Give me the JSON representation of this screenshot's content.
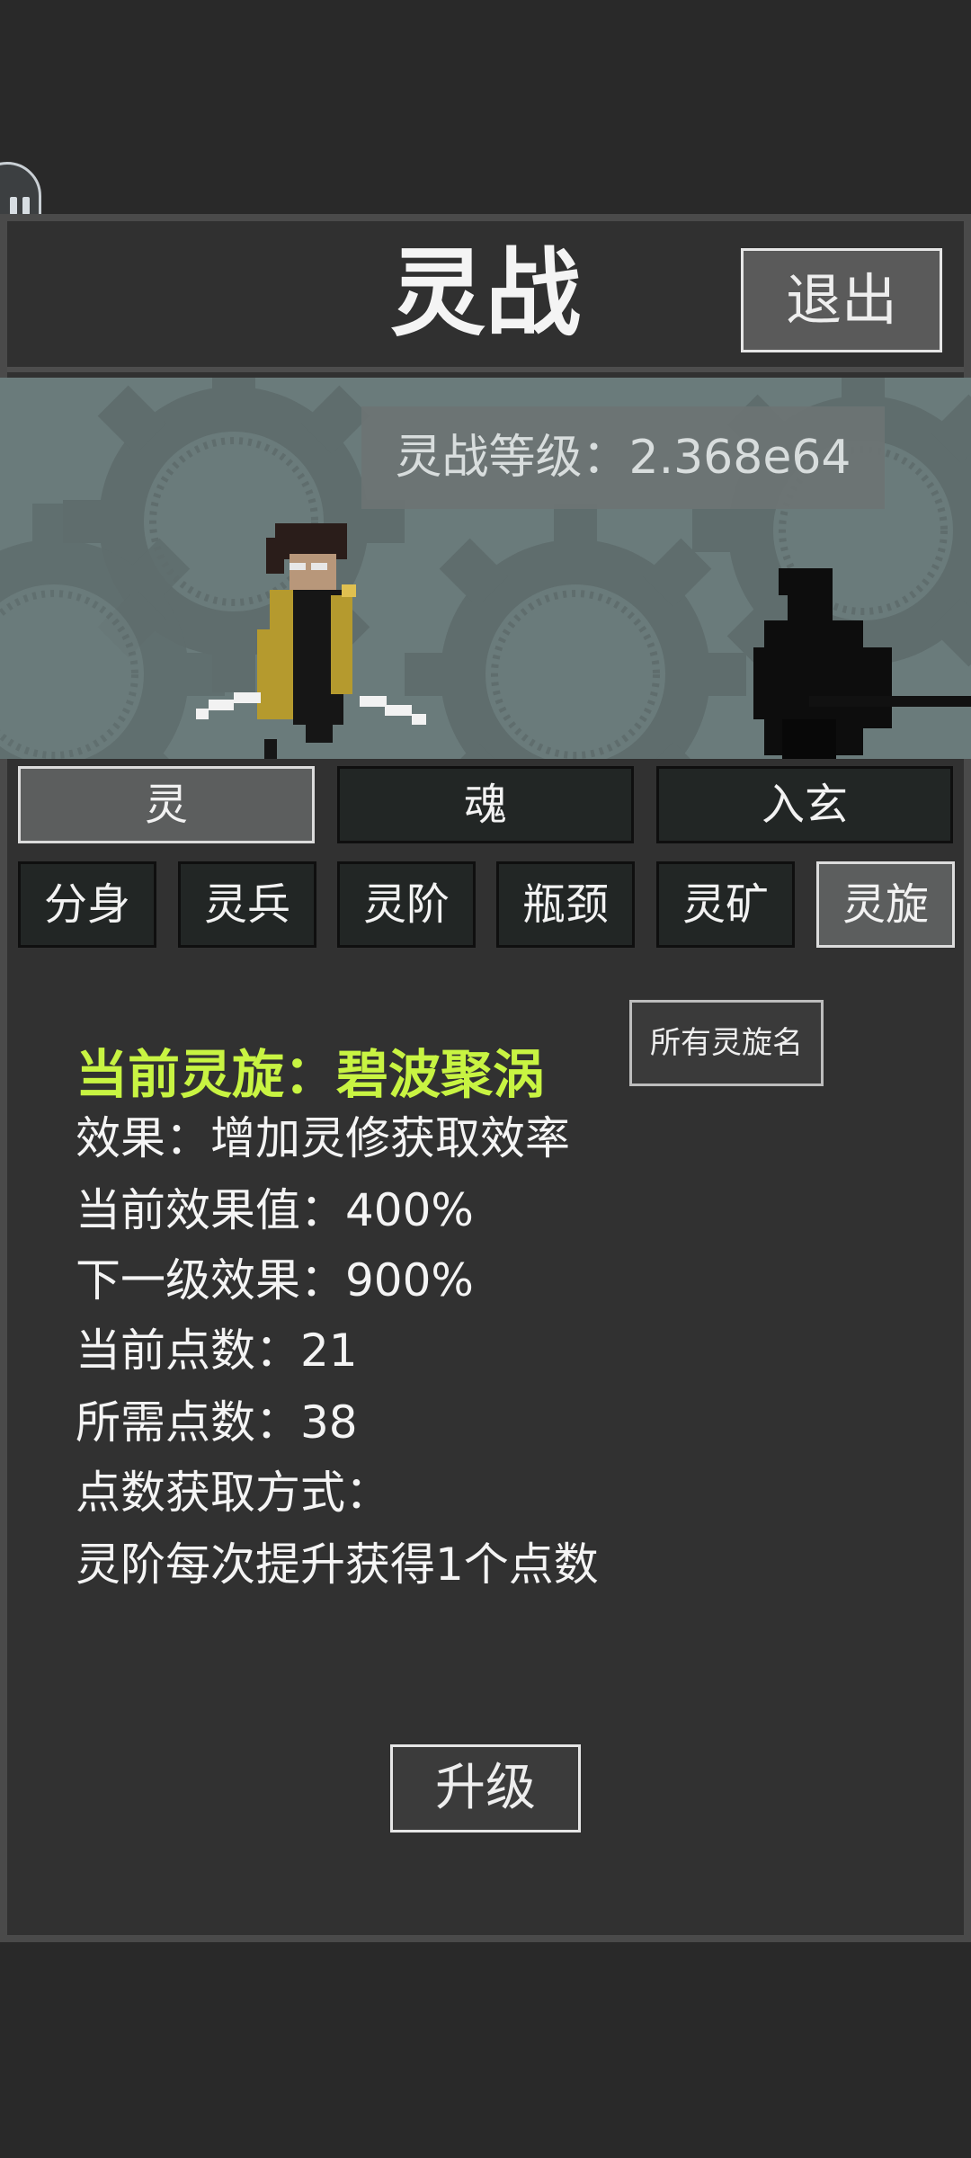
{
  "header": {
    "title": "灵战",
    "exit_label": "退出"
  },
  "scene": {
    "level_text": "灵战等级：2.368e64"
  },
  "tabs_main": [
    {
      "label": "灵",
      "active": true
    },
    {
      "label": "魂",
      "active": false
    },
    {
      "label": "入玄",
      "active": false
    }
  ],
  "tabs_sub": [
    {
      "label": "分身",
      "active": false
    },
    {
      "label": "灵兵",
      "active": false
    },
    {
      "label": "灵阶",
      "active": false
    },
    {
      "label": "瓶颈",
      "active": false
    },
    {
      "label": "灵矿",
      "active": false
    },
    {
      "label": "灵旋",
      "active": true
    }
  ],
  "content": {
    "all_names_label": "所有灵旋名",
    "current": "当前灵旋：碧波聚涡",
    "effect": "效果：增加灵修获取效率",
    "current_value": "当前效果值：400%",
    "next_value": "下一级效果：900%",
    "current_points": "当前点数：21",
    "required_points": "所需点数：38",
    "points_method_title": "点数获取方式：",
    "points_method": "灵阶每次提升获得1个点数",
    "upgrade_label": "升级"
  },
  "colors": {
    "background": "#292929",
    "panel": "#313131",
    "highlight_text": "#c8f442",
    "scene_bg": "#6a7b7b",
    "character_robe": "#b59a2e"
  },
  "icons": {
    "pause": "pause-icon"
  }
}
